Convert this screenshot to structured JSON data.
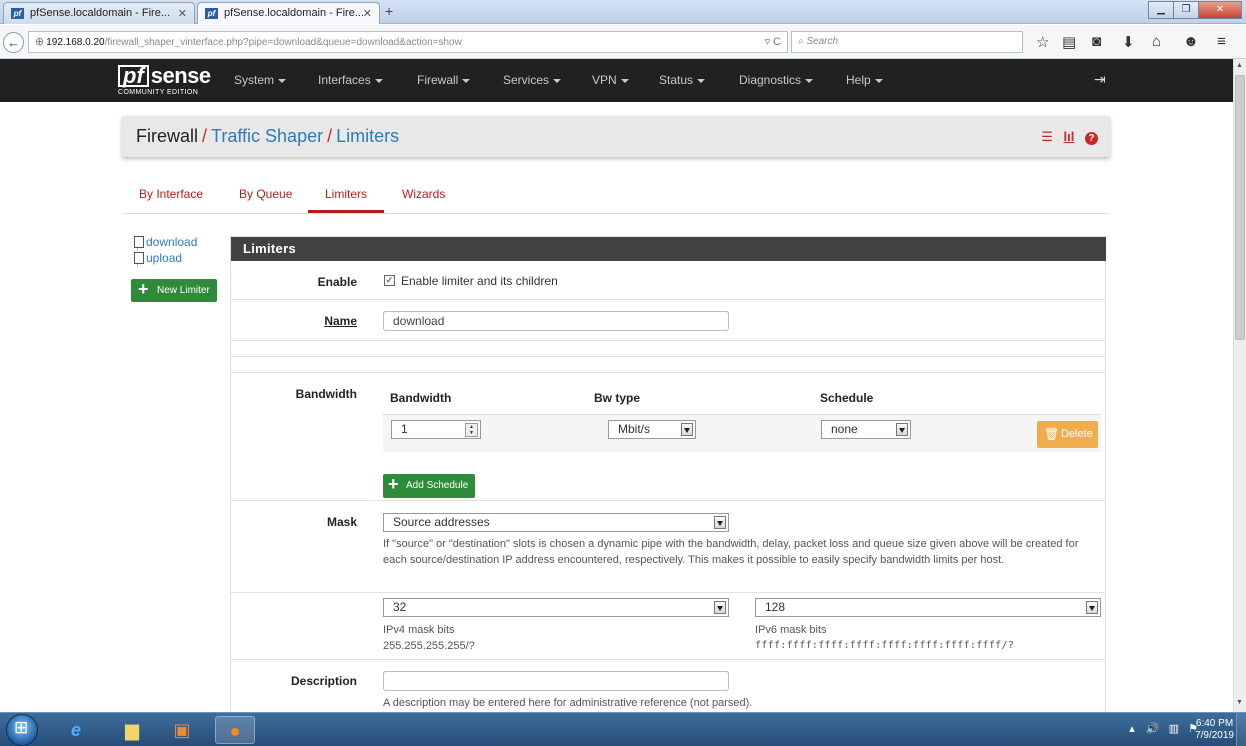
{
  "browser": {
    "tabs": [
      {
        "title": "pfSense.localdomain - Fire..."
      },
      {
        "title": "pfSense.localdomain - Fire..."
      }
    ],
    "url_host": "192.168.0.20",
    "url_path": "/firewall_shaper_vinterface.php?pipe=download&queue=download&action=show",
    "search_placeholder": "Search"
  },
  "pfsense": {
    "logo_text": "sense",
    "logo_badge": "pf",
    "edition": "COMMUNITY EDITION",
    "menu": [
      "System",
      "Interfaces",
      "Firewall",
      "Services",
      "VPN",
      "Status",
      "Diagnostics",
      "Help"
    ]
  },
  "breadcrumb": {
    "root": "Firewall",
    "level1": "Traffic Shaper",
    "level2": "Limiters",
    "sep": "/"
  },
  "tabs": [
    "By Interface",
    "By Queue",
    "Limiters",
    "Wizards"
  ],
  "active_tab": "Limiters",
  "tree": [
    "download",
    "upload"
  ],
  "new_limiter_label": "New Limiter",
  "panel": {
    "title": "Limiters",
    "enable_label": "Enable",
    "enable_text": "Enable limiter and its children",
    "enable_checked": true,
    "name_label": "Name",
    "name_value": "download",
    "bandwidth_label": "Bandwidth",
    "bw_headers": [
      "Bandwidth",
      "Bw type",
      "Schedule"
    ],
    "bw_value": "1",
    "bw_type": "Mbit/s",
    "schedule": "none",
    "delete_label": "Delete",
    "add_schedule_label": "Add Schedule",
    "mask_label": "Mask",
    "mask_value": "Source addresses",
    "mask_help": "If \"source\" or \"destination\" slots is chosen a dynamic pipe with the bandwidth, delay, packet loss and queue size given above will be created for each source/destination IP address encountered, respectively. This makes it possible to easily specify bandwidth limits per host.",
    "ipv4_bits": "32",
    "ipv4_label": "IPv4 mask bits",
    "ipv4_example": "255.255.255.255/?",
    "ipv6_bits": "128",
    "ipv6_label": "IPv6 mask bits",
    "ipv6_example": "ffff:ffff:ffff:ffff:ffff:ffff:ffff:ffff/?",
    "description_label": "Description",
    "description_value": "",
    "description_help": "A description may be entered here for administrative reference (not parsed)."
  },
  "taskbar": {
    "time": "6:40 PM",
    "date": "7/9/2019"
  },
  "colors": {
    "pf_red": "#b71c1c",
    "link_blue": "#2e7bbd",
    "success_green": "#2e8b3a",
    "warning_orange": "#f0ad4e",
    "nav_dark": "#212121"
  }
}
